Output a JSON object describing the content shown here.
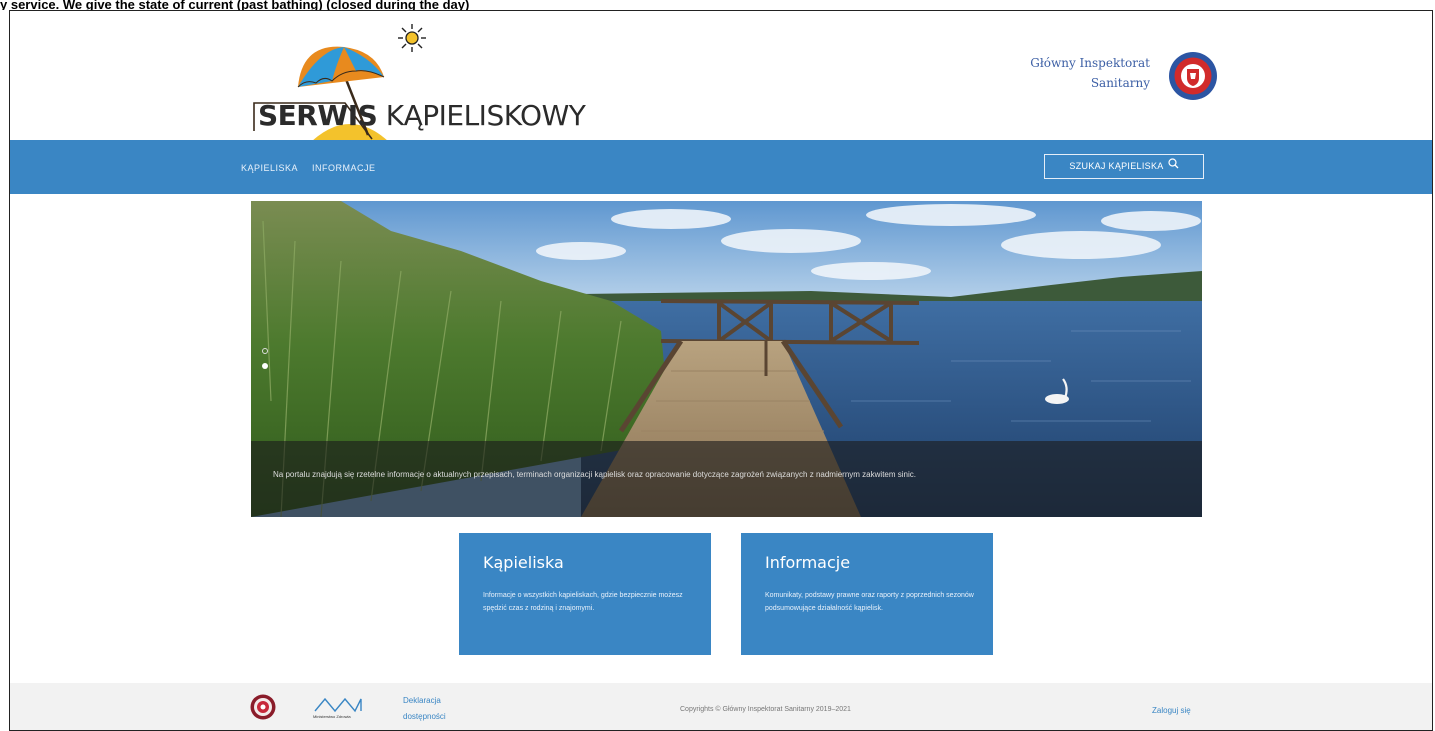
{
  "page_caption": "y service. We give the state of current (past bathing) (closed during the day)",
  "header": {
    "logo_bold": "SERWIS",
    "logo_light": "KĄPIELISKOWY",
    "gis_line1": "Główny Inspektorat",
    "gis_line2": "Sanitarny"
  },
  "nav": {
    "items": [
      "KĄPIELISKA",
      "INFORMACJE"
    ],
    "search_label": "SZUKAJ KĄPIELISKA"
  },
  "hero": {
    "caption": "Na portalu znajdują się rzetelne informacje o aktualnych przepisach, terminach organizacji kąpielisk oraz opracowanie dotyczące zagrożeń związanych z nadmiernym zakwitem sinic.",
    "slide_count": 2,
    "active_slide": 2
  },
  "cards": [
    {
      "title": "Kąpieliska",
      "description": "Informacje o wszystkich kąpieliskach, gdzie bezpiecznie możesz spędzić czas z rodziną i znajomymi."
    },
    {
      "title": "Informacje",
      "description": "Komunikaty, podstawy prawne oraz raporty z poprzednich sezonów podsumowujące działalność kąpielisk."
    }
  ],
  "footer": {
    "mz_label": "Ministerstwo Zdrowia",
    "accessibility_line1": "Deklaracja",
    "accessibility_line2": "dostępności",
    "copyright": "Copyrights © Główny Inspektorat Sanitarny 2019–2021",
    "login": "Zaloguj się"
  },
  "colors": {
    "accent_blue": "#3a86c4",
    "footer_bg": "#f2f2f2",
    "gis_red": "#d12b2b",
    "umbrella_orange": "#e88a1e",
    "umbrella_blue": "#2f9ad8",
    "sand_yellow": "#f3c22c"
  },
  "icons": [
    "sun-icon",
    "umbrella-icon",
    "gis-seal-icon",
    "search-icon",
    "mz-logo-icon"
  ]
}
